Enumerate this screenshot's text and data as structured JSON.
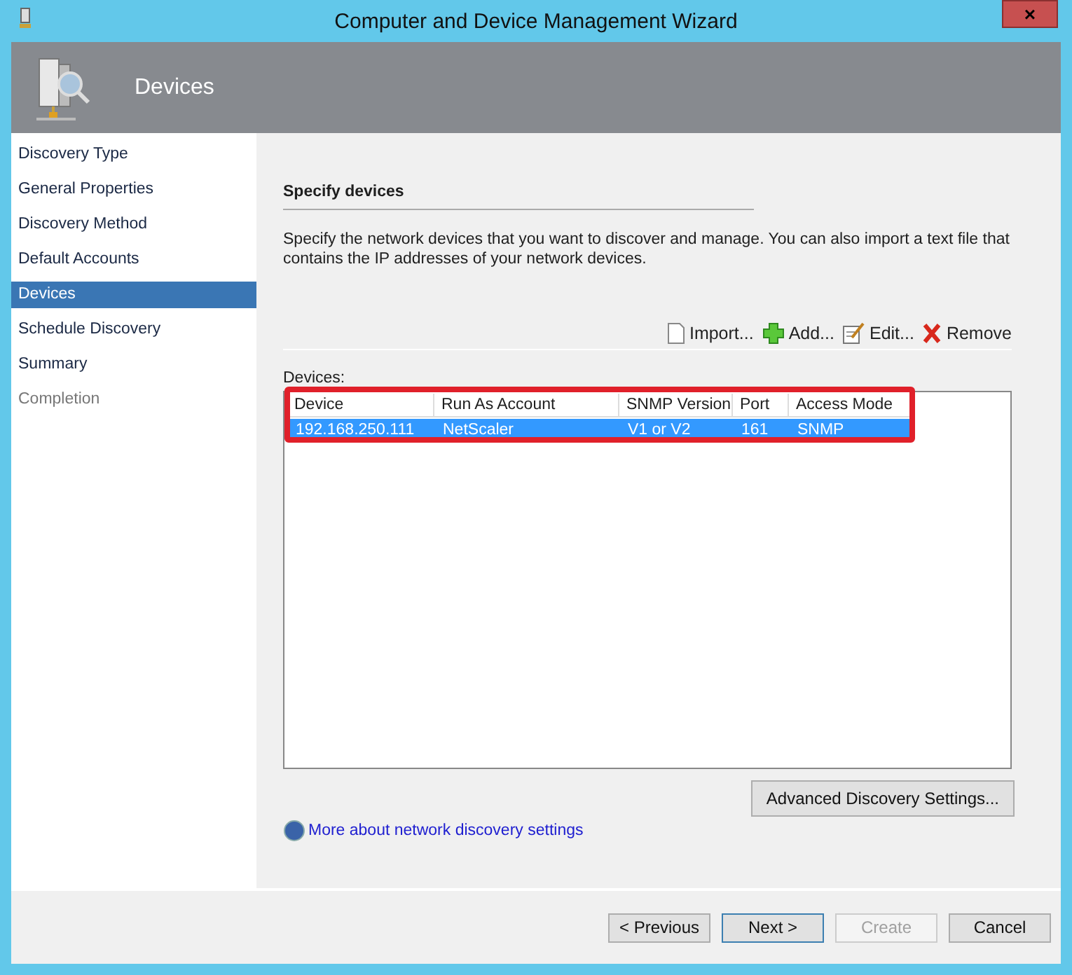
{
  "window": {
    "title": "Computer and Device Management Wizard",
    "close": "×"
  },
  "header": {
    "title": "Devices"
  },
  "steps": [
    {
      "label": "Discovery Type",
      "selected": false,
      "disabled": false
    },
    {
      "label": "General Properties",
      "selected": false,
      "disabled": false
    },
    {
      "label": "Discovery Method",
      "selected": false,
      "disabled": false
    },
    {
      "label": "Default Accounts",
      "selected": false,
      "disabled": false
    },
    {
      "label": "Devices",
      "selected": true,
      "disabled": false
    },
    {
      "label": "Schedule Discovery",
      "selected": false,
      "disabled": false
    },
    {
      "label": "Summary",
      "selected": false,
      "disabled": false
    },
    {
      "label": "Completion",
      "selected": false,
      "disabled": true
    }
  ],
  "section": {
    "title": "Specify devices",
    "description": "Specify the network devices that you want to discover and manage. You can also import a text file that contains the IP addresses of your network devices."
  },
  "toolbar": [
    {
      "kind": "import",
      "label": "Import..."
    },
    {
      "kind": "add",
      "label": "Add..."
    },
    {
      "kind": "edit",
      "label": "Edit..."
    },
    {
      "kind": "remove",
      "label": "Remove"
    }
  ],
  "table": {
    "label": "Devices:",
    "columns": [
      "Device",
      "Run As Account",
      "SNMP Version",
      "Port",
      "Access Mode"
    ],
    "rows": [
      {
        "cells": [
          "192.168.250.111",
          "NetScaler",
          "V1 or V2",
          "161",
          "SNMP"
        ],
        "selected": true
      }
    ]
  },
  "advanced_button": "Advanced Discovery Settings...",
  "help_link": "More about network discovery settings",
  "buttons": [
    {
      "label": "< Previous",
      "default": false,
      "disabled": false
    },
    {
      "label": "Next >",
      "default": true,
      "disabled": false
    },
    {
      "label": "Create",
      "default": false,
      "disabled": true
    },
    {
      "label": "Cancel",
      "default": false,
      "disabled": false
    }
  ]
}
